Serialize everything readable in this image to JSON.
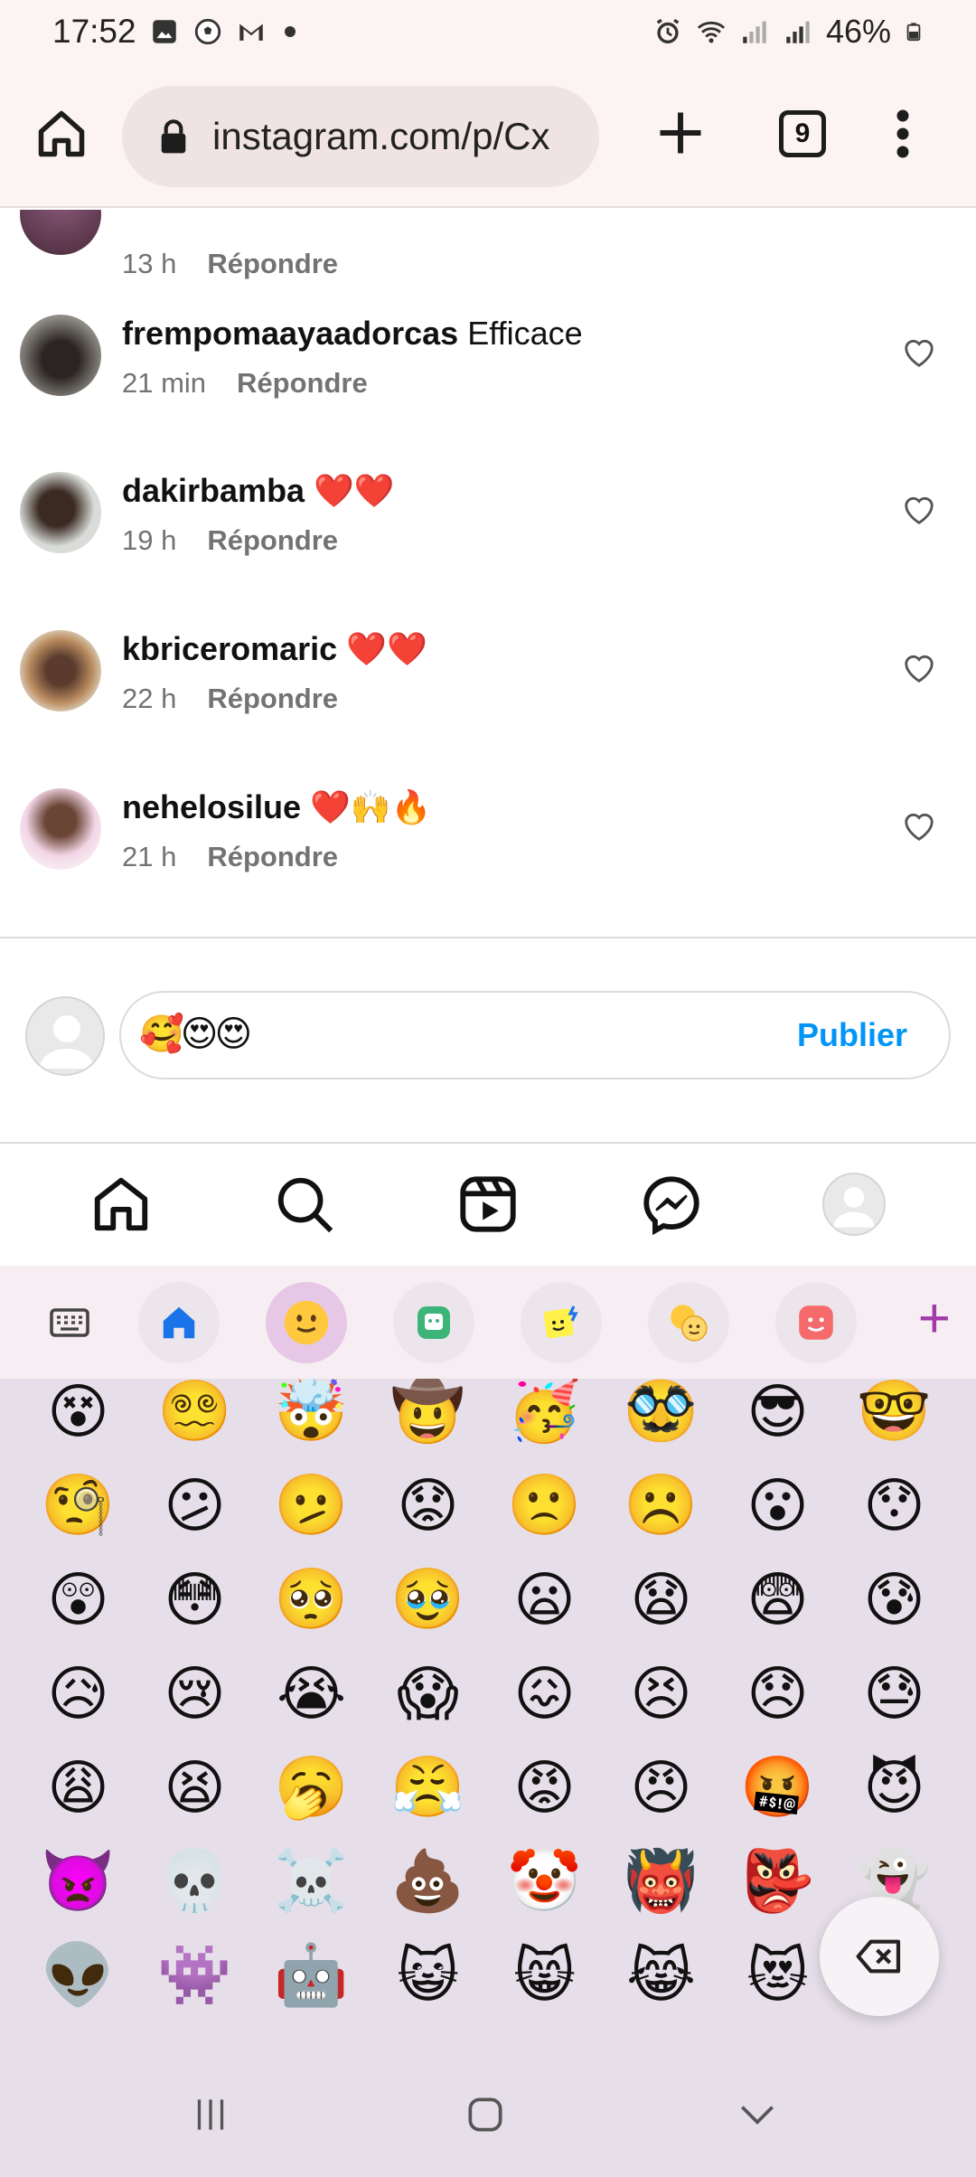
{
  "status_bar": {
    "time": "17:52",
    "battery": "46%"
  },
  "browser": {
    "url": "instagram.com/p/Cx",
    "tab_count": "9"
  },
  "comments": [
    {
      "time": "13 h",
      "reply_label": "Répondre"
    },
    {
      "user": "frempomaayaadorcas",
      "text": "Efficace",
      "time": "21 min",
      "reply_label": "Répondre"
    },
    {
      "user": "dakirbamba",
      "text": "❤️❤️",
      "time": "19 h",
      "reply_label": "Répondre"
    },
    {
      "user": "kbriceromaric",
      "text": "❤️❤️",
      "time": "22 h",
      "reply_label": "Répondre"
    },
    {
      "user": "nehelosilue",
      "text": "❤️🙌🔥",
      "time": "21 h",
      "reply_label": "Répondre"
    }
  ],
  "composer": {
    "value": "🥰😍😍",
    "publish_label": "Publier"
  },
  "keyboard": {
    "tabs": [
      "keyboard-icon",
      "home-icon",
      "emoji-icon",
      "sticker-icon",
      "bitmoji-icon",
      "emoji-mix-icon",
      "avatar-sticker-icon"
    ],
    "emojis": [
      "😵",
      "😵‍💫",
      "🤯",
      "🤠",
      "🥳",
      "🥸",
      "😎",
      "🤓",
      "🧐",
      "😕",
      "🫤",
      "😟",
      "🙁",
      "☹️",
      "😮",
      "😯",
      "😲",
      "😳",
      "🥺",
      "🥹",
      "😦",
      "😧",
      "😨",
      "😰",
      "😥",
      "😢",
      "😭",
      "😱",
      "😖",
      "😣",
      "😞",
      "😓",
      "😩",
      "😫",
      "🥱",
      "😤",
      "😡",
      "😠",
      "🤬",
      "😈",
      "👿",
      "💀",
      "☠️",
      "💩",
      "🤡",
      "👹",
      "👺",
      "👻",
      "👽",
      "👾",
      "🤖",
      "😺",
      "😸",
      "😹",
      "😻",
      "😼"
    ]
  }
}
